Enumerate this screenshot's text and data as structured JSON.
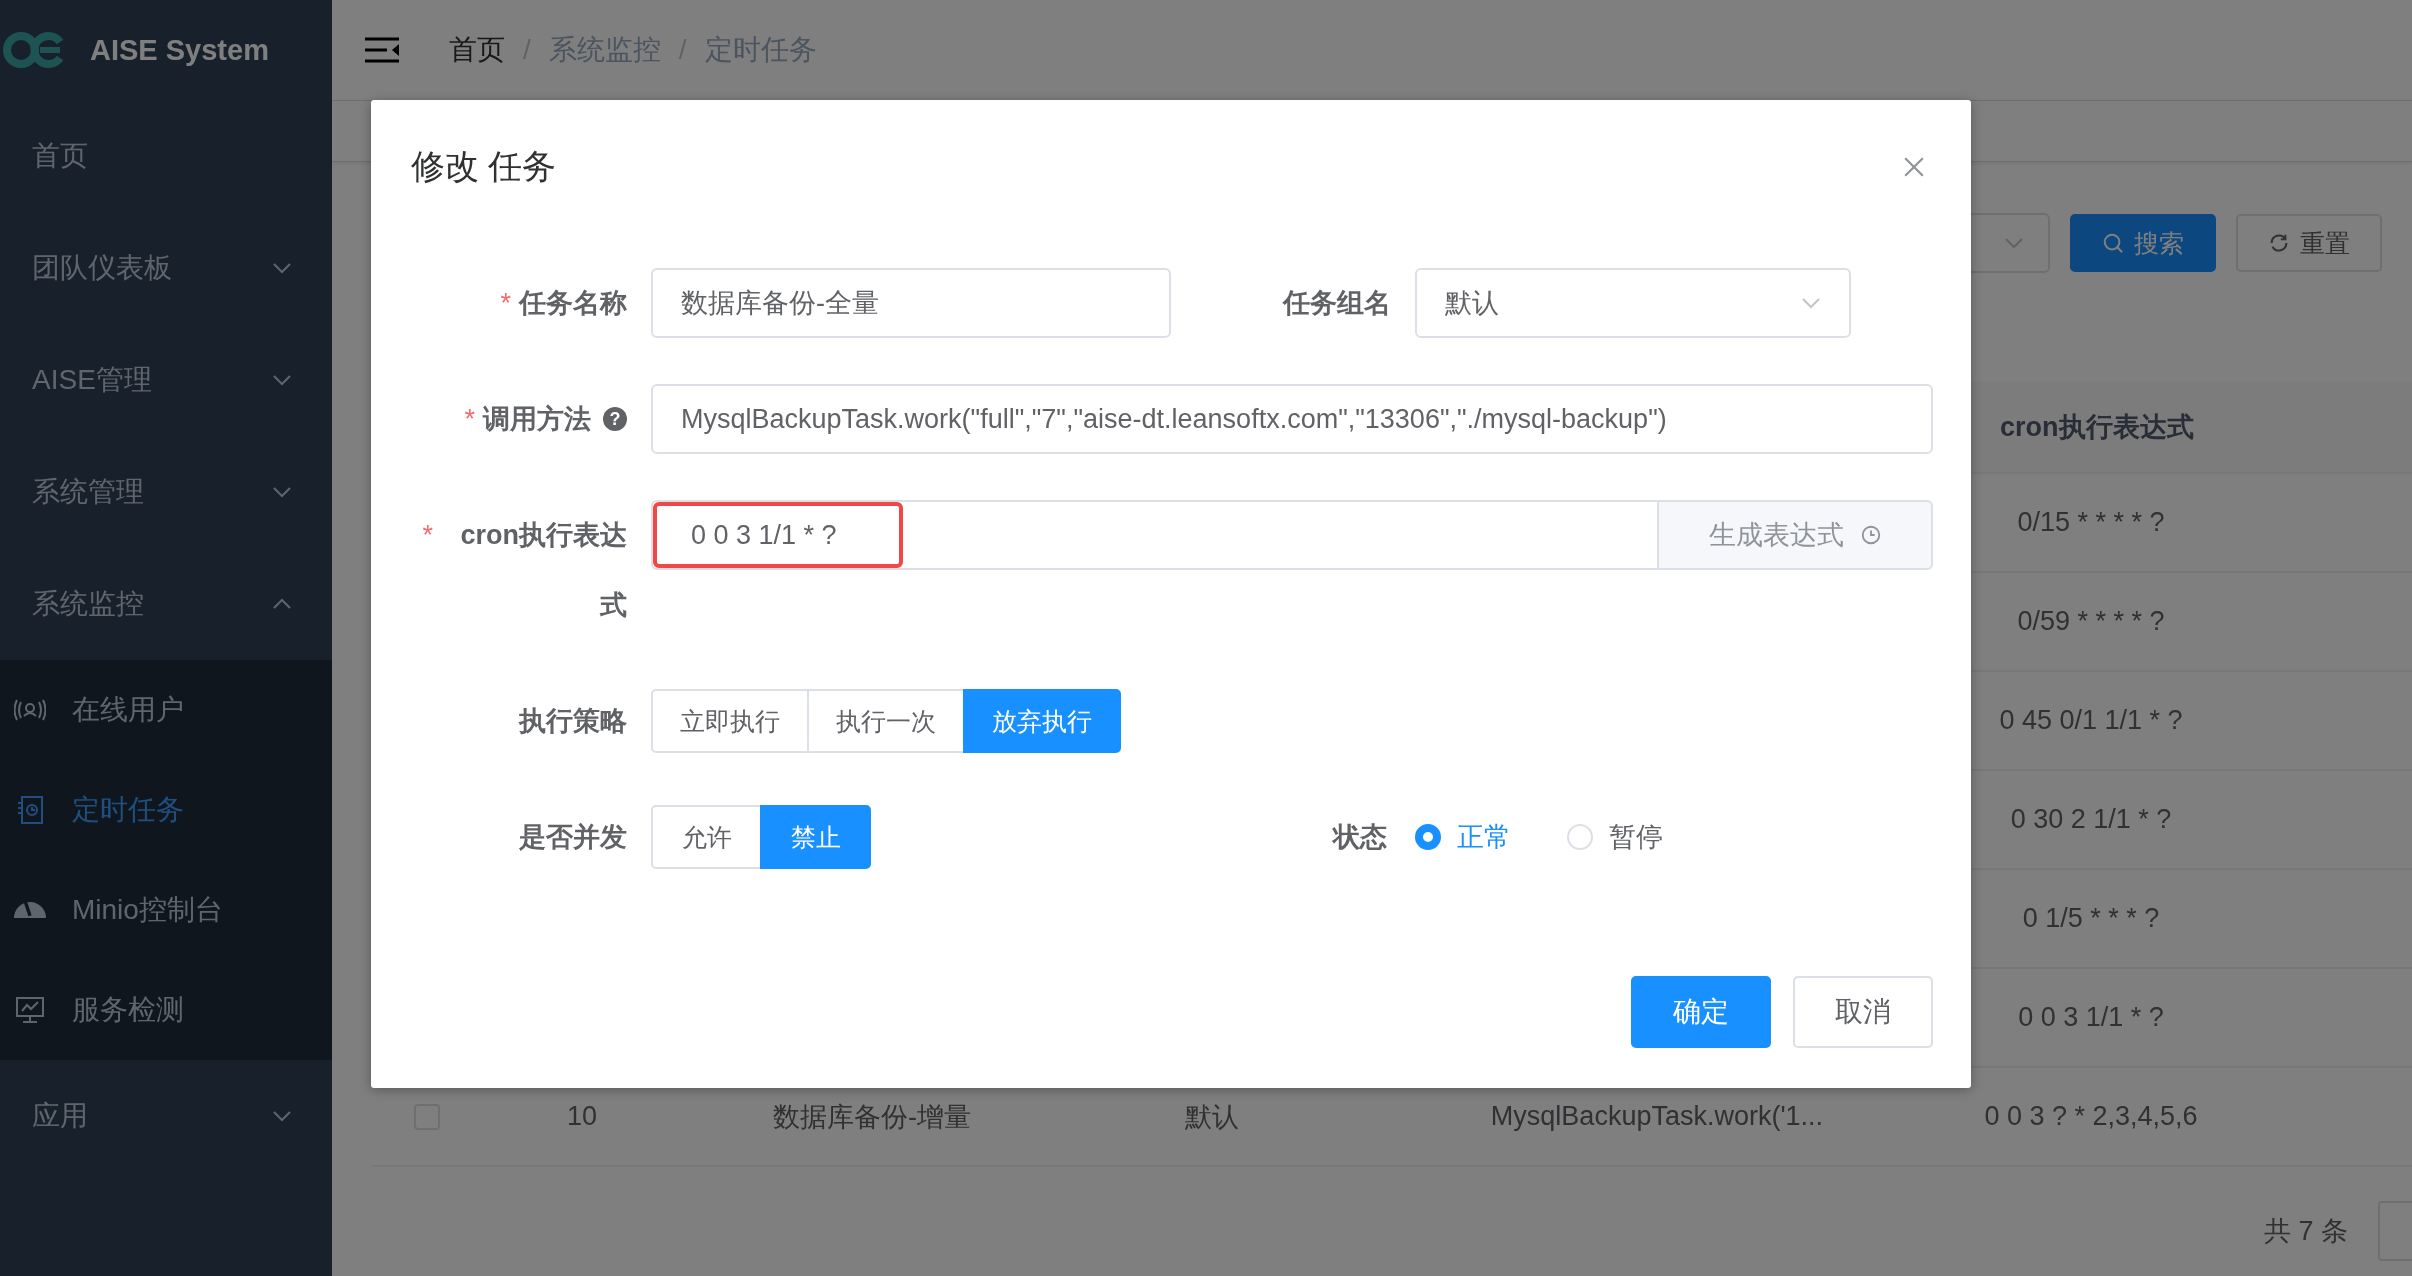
{
  "sidebar": {
    "brand": "AISE System",
    "items": [
      {
        "label": "首页",
        "kind": "link"
      },
      {
        "label": "团队仪表板",
        "kind": "submenu",
        "expanded": false
      },
      {
        "label": "AISE管理",
        "kind": "submenu",
        "expanded": false
      },
      {
        "label": "系统管理",
        "kind": "submenu",
        "expanded": false
      },
      {
        "label": "系统监控",
        "kind": "submenu",
        "expanded": true,
        "children": [
          {
            "label": "在线用户",
            "selected": false
          },
          {
            "label": "定时任务",
            "selected": true
          },
          {
            "label": "Minio控制台",
            "selected": false
          },
          {
            "label": "服务检测",
            "selected": false
          }
        ]
      },
      {
        "label": "应用",
        "kind": "submenu",
        "expanded": false
      }
    ]
  },
  "breadcrumb": {
    "items": [
      "首页",
      "系统监控",
      "定时任务"
    ],
    "separator": "/"
  },
  "search_bar": {
    "buttons": [
      {
        "label": "搜索",
        "kind": "primary"
      },
      {
        "label": "重置",
        "kind": "default"
      }
    ]
  },
  "table": {
    "columns": [
      "cron执行表达式"
    ],
    "rows": [
      {
        "cron": "0/15 * * * * ?"
      },
      {
        "cron": "0/59 * * * * ?"
      },
      {
        "cron": "0 45 0/1 1/1 * ?"
      },
      {
        "cron": "0 30 2 1/1 * ?"
      },
      {
        "cron": "0 1/5 * * * ?"
      },
      {
        "cron": "0 0 3 1/1 * ?"
      },
      {
        "checked": false,
        "id": "10",
        "name": "数据库备份-增量",
        "group": "默认",
        "method": "MysqlBackupTask.work('1...",
        "cron": "0 0 3 ? * 2,3,4,5,6"
      }
    ]
  },
  "pagination": {
    "total": "共 7 条"
  },
  "dialog": {
    "title": "修改 任务",
    "task_name": {
      "label": "任务名称",
      "required_mark": "*",
      "value": "数据库备份-全量"
    },
    "task_group": {
      "label": "任务组名",
      "value": "默认"
    },
    "invoke_target": {
      "label": "调用方法",
      "required_mark": "*",
      "help": "?",
      "value": "MysqlBackupTask.work(\"full\",\"7\",\"aise-dt.leansoftx.com\",\"13306\",\"./mysql-backup\")"
    },
    "cron": {
      "label": "cron执行表达式",
      "required_mark": "*",
      "value": "0 0 3 1/1 * ?",
      "highlighted": true,
      "button": "生成表达式"
    },
    "misfire": {
      "label": "执行策略",
      "options": [
        {
          "label": "立即执行",
          "selected": false
        },
        {
          "label": "执行一次",
          "selected": false
        },
        {
          "label": "放弃执行",
          "selected": true
        }
      ]
    },
    "concurrent": {
      "label": "是否并发",
      "options": [
        {
          "label": "允许",
          "selected": false
        },
        {
          "label": "禁止",
          "selected": true
        }
      ]
    },
    "status": {
      "label": "状态",
      "options": [
        {
          "label": "正常",
          "selected": true
        },
        {
          "label": "暂停",
          "selected": false
        }
      ]
    },
    "buttons": [
      {
        "label": "确定",
        "kind": "primary"
      },
      {
        "label": "取消",
        "kind": "default"
      }
    ]
  }
}
